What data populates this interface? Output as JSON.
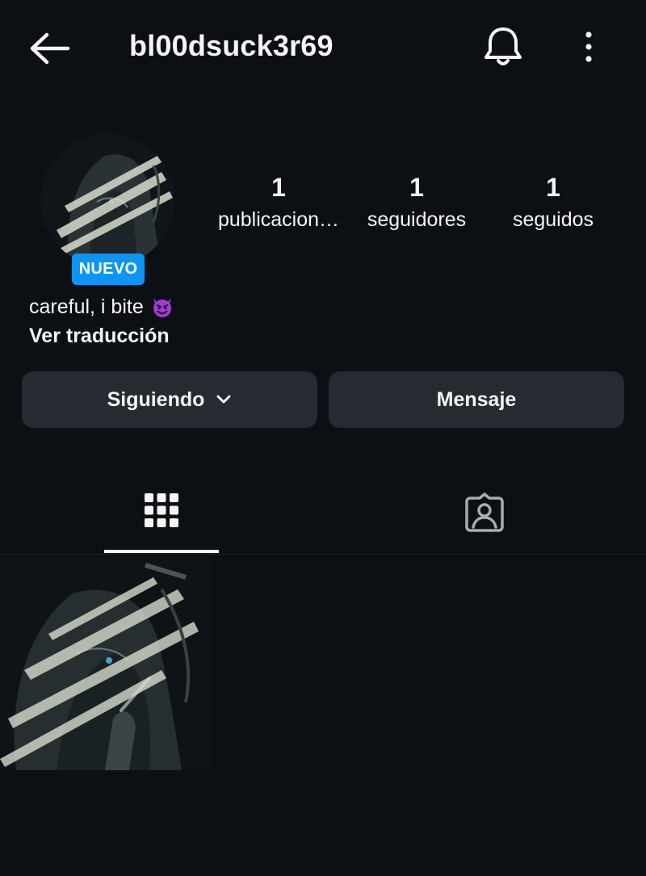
{
  "header": {
    "username": "bl00dsuck3r69",
    "back_icon": "arrow-left-icon",
    "notifications_icon": "bell-icon",
    "more_icon": "more-vertical-icon"
  },
  "profile": {
    "badge": "NUEVO",
    "stats": {
      "posts": {
        "count": "1",
        "label": "publicacion…"
      },
      "followers": {
        "count": "1",
        "label": "seguidores"
      },
      "following": {
        "count": "1",
        "label": "seguidos"
      }
    },
    "bio": "careful, i bite",
    "bio_emoji_icon": "smiling-devil-emoji",
    "translate_label": "Ver traducción"
  },
  "actions": {
    "following_label": "Siguiendo",
    "message_label": "Mensaje"
  },
  "tabs": [
    {
      "id": "posts",
      "icon": "grid-icon",
      "active": true
    },
    {
      "id": "tagged",
      "icon": "tagged-person-icon",
      "active": false
    }
  ],
  "colors": {
    "background": "#0c0f14",
    "button": "#262a31",
    "badge": "#0d95f6",
    "text": "#f5f5f5",
    "emoji": "#a23bd1"
  }
}
